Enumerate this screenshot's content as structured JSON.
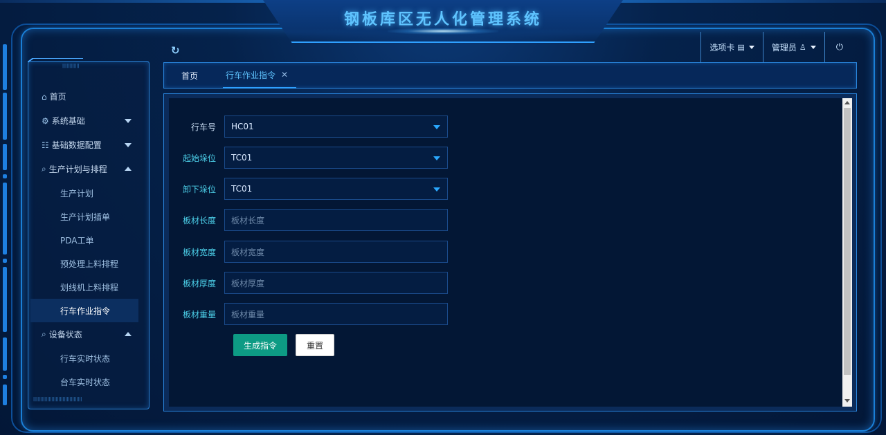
{
  "header": {
    "title": "钢板库区无人化管理系统",
    "tab_options_label": "选项卡",
    "user_label": "管理员"
  },
  "sidebar": {
    "items": [
      {
        "label": "首页",
        "icon": "home-icon"
      },
      {
        "label": "系统基础",
        "icon": "gear-icon"
      },
      {
        "label": "基础数据配置",
        "icon": "grid-icon"
      },
      {
        "label": "生产计划与排程",
        "icon": "search-icon"
      }
    ],
    "plan_sub": [
      "生产计划",
      "生产计划插单",
      "PDA工单",
      "预处理上料排程",
      "划线机上料排程",
      "行车作业指令"
    ],
    "device_label": "设备状态",
    "device_sub": [
      "行车实时状态",
      "台车实时状态"
    ]
  },
  "tabs": [
    {
      "label": "首页"
    },
    {
      "label": "行车作业指令"
    }
  ],
  "form": {
    "crane": {
      "label": "行车号",
      "value": "HC01"
    },
    "start_pos": {
      "label": "起始垛位",
      "value": "TC01"
    },
    "end_pos": {
      "label": "卸下垛位",
      "value": "TC01"
    },
    "length": {
      "label": "板材长度",
      "placeholder": "板材长度"
    },
    "width": {
      "label": "板材宽度",
      "placeholder": "板材宽度"
    },
    "thickness": {
      "label": "板材厚度",
      "placeholder": "板材厚度"
    },
    "weight": {
      "label": "板材重量",
      "placeholder": "板材重量"
    },
    "submit_label": "生成指令",
    "reset_label": "重置"
  },
  "colors": {
    "accent": "#2fa0ff",
    "primary_button": "#0d9b84",
    "label_cyan": "#4ccfe8"
  }
}
